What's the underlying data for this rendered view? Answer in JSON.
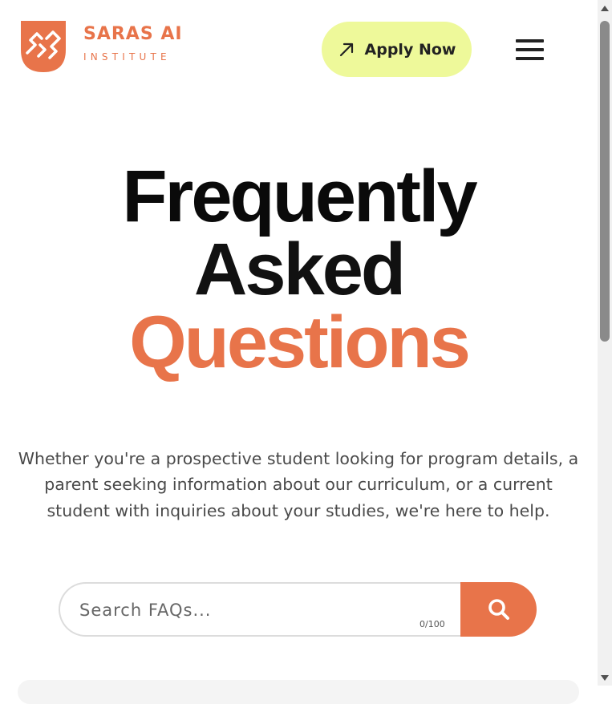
{
  "brand": {
    "name": "SARAS AI",
    "subtitle": "INSTITUTE",
    "color": "#E8744A"
  },
  "header": {
    "apply_label": "Apply Now",
    "apply_icon": "arrow-up-right-icon",
    "apply_bg": "#EEF99A",
    "menu_icon": "hamburger-menu-icon"
  },
  "hero": {
    "line1": "Frequently",
    "line2": "Asked",
    "line3": "Questions",
    "description": "Whether you're a prospective student looking for program details, a parent seeking information about our curriculum, or a current student with inquiries about your studies, we're here to help."
  },
  "search": {
    "placeholder": "Search FAQs...",
    "value": "",
    "char_count": "0/100",
    "button_icon": "search-icon",
    "accent": "#E8744A"
  }
}
